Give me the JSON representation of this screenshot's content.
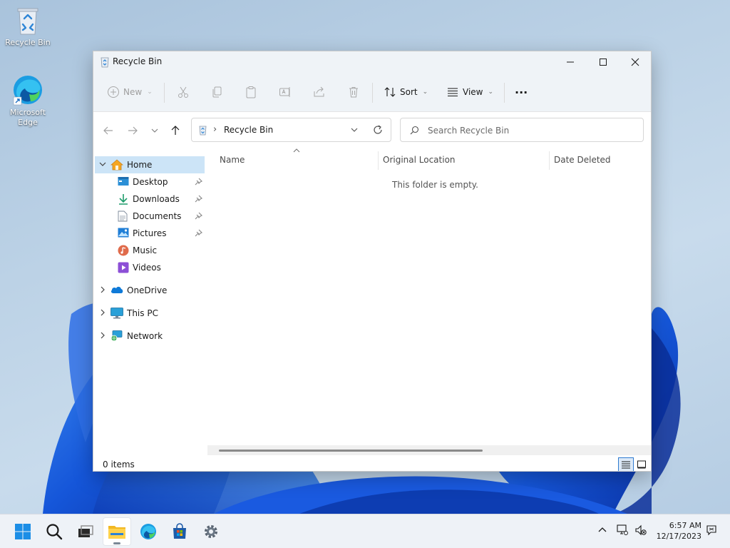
{
  "desktop": {
    "icons": [
      {
        "label": "Recycle Bin"
      },
      {
        "label": "Microsoft Edge"
      }
    ]
  },
  "window": {
    "title": "Recycle Bin",
    "commandbar": {
      "new_label": "New",
      "sort_label": "Sort",
      "view_label": "View",
      "more_label": "···"
    },
    "address": {
      "separator": "›",
      "location": "Recycle Bin"
    },
    "search": {
      "placeholder": "Search Recycle Bin"
    },
    "navpane": {
      "home": "Home",
      "quick_access": [
        {
          "label": "Desktop",
          "pinned": true
        },
        {
          "label": "Downloads",
          "pinned": true
        },
        {
          "label": "Documents",
          "pinned": true
        },
        {
          "label": "Pictures",
          "pinned": true
        },
        {
          "label": "Music",
          "pinned": false
        },
        {
          "label": "Videos",
          "pinned": false
        }
      ],
      "onedrive": "OneDrive",
      "this_pc": "This PC",
      "network": "Network"
    },
    "content": {
      "columns": [
        "Name",
        "Original Location",
        "Date Deleted"
      ],
      "empty_message": "This folder is empty."
    },
    "status": {
      "item_count": "0 items"
    }
  },
  "taskbar": {
    "time": "6:57 AM",
    "date": "12/17/2023"
  },
  "colors": {
    "accent": "#0067c0",
    "selection": "#cce4f7",
    "wallpaper_blue": "#1a5ae0"
  }
}
